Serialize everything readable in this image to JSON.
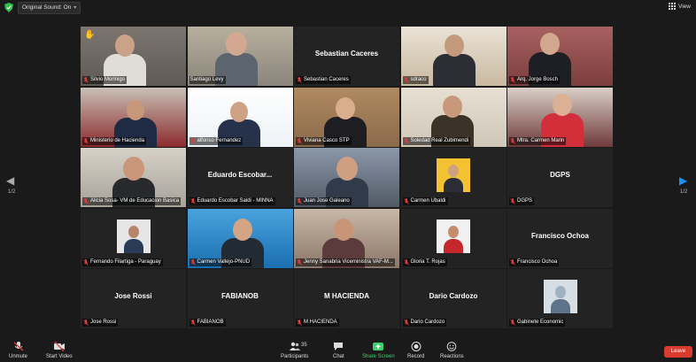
{
  "topbar": {
    "language_label": "Original Sound: On",
    "view_label": "View"
  },
  "pager": {
    "left_page": "1/2",
    "right_page": "1/2"
  },
  "tiles": [
    {
      "label": "Silvio Morinigo",
      "center_name": "",
      "muted": true,
      "hand": true,
      "scene": "video"
    },
    {
      "label": "Santiago Levy",
      "center_name": "",
      "muted": false,
      "active": true,
      "scene": "video"
    },
    {
      "label": "Sebastian Caceres",
      "center_name": "Sebastian Caceres",
      "muted": true,
      "scene": "name"
    },
    {
      "label": "sdraco",
      "center_name": "",
      "muted": true,
      "scene": "video"
    },
    {
      "label": "Arq. Jorge Bosch",
      "center_name": "",
      "muted": true,
      "scene": "video"
    },
    {
      "label": "Ministerio de Hacienda",
      "center_name": "",
      "muted": true,
      "scene": "video"
    },
    {
      "label": "alfonso Fernandez",
      "center_name": "",
      "muted": true,
      "scene": "video"
    },
    {
      "label": "Viviana Casco STP",
      "center_name": "",
      "muted": true,
      "scene": "video"
    },
    {
      "label": "Soledad Real Zubimendi",
      "center_name": "",
      "muted": true,
      "scene": "video"
    },
    {
      "label": "Mtra. Carmen Marin",
      "center_name": "",
      "muted": true,
      "scene": "video"
    },
    {
      "label": "Alicia Sosa- VM de Educacion Basica",
      "center_name": "",
      "muted": true,
      "scene": "video"
    },
    {
      "label": "Eduardo Escobar Saldi - MINNA",
      "center_name": "Eduardo Escobar...",
      "muted": true,
      "scene": "name"
    },
    {
      "label": "Juan Jose Galeano",
      "center_name": "",
      "muted": true,
      "scene": "video"
    },
    {
      "label": "Carmen Ubaldi",
      "center_name": "",
      "muted": true,
      "scene": "avatar"
    },
    {
      "label": "DGPS",
      "center_name": "DGPS",
      "muted": true,
      "scene": "name"
    },
    {
      "label": "Fernando Filartiga - Paraguay",
      "center_name": "",
      "muted": true,
      "scene": "avatar"
    },
    {
      "label": "Carmen Vallejo-PNUD",
      "center_name": "",
      "muted": true,
      "scene": "video"
    },
    {
      "label": "Jenny Sanabria Viceministra VAF-M...",
      "center_name": "",
      "muted": true,
      "scene": "video"
    },
    {
      "label": "Gloria T. Rojas",
      "center_name": "",
      "muted": true,
      "scene": "avatar"
    },
    {
      "label": "Francisco Ochoa",
      "center_name": "Francisco Ochoa",
      "muted": true,
      "scene": "name"
    },
    {
      "label": "Jose Rossi",
      "center_name": "Jose Rossi",
      "muted": true,
      "scene": "name"
    },
    {
      "label": "FABIANOB",
      "center_name": "FABIANOB",
      "muted": true,
      "scene": "name"
    },
    {
      "label": "M HACIENDA",
      "center_name": "M HACIENDA",
      "muted": true,
      "scene": "name"
    },
    {
      "label": "Dario Cardozo",
      "center_name": "Dario Cardozo",
      "muted": true,
      "scene": "name"
    },
    {
      "label": "Gabinete Economic",
      "center_name": "",
      "muted": true,
      "scene": "avatar"
    }
  ],
  "toolbar": {
    "unmute": "Unmute",
    "start_video": "Start Video",
    "participants": "Participants",
    "participant_count": "35",
    "chat": "Chat",
    "share_screen": "Share Screen",
    "record": "Record",
    "reactions": "Reactions",
    "leave": "Leave"
  }
}
